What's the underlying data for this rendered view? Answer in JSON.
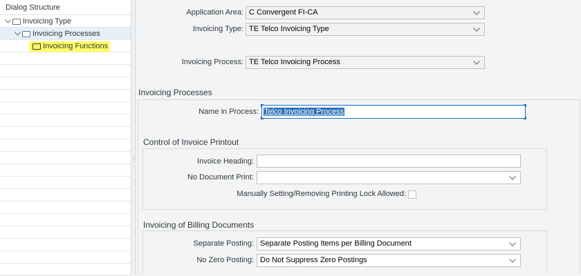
{
  "dialog_structure": {
    "title": "Dialog Structure",
    "items": [
      {
        "label": "Invoicing Type"
      },
      {
        "label": "Invoicing Processes"
      },
      {
        "label": "Invoicing Functions"
      }
    ]
  },
  "header_fields": {
    "application_area": {
      "label": "Application Area:",
      "value": "C Convergent FI-CA"
    },
    "invoicing_type": {
      "label": "Invoicing Type:",
      "value": "TE Telco Invoicing Type"
    },
    "invoicing_process": {
      "label": "Invoicing Process:",
      "value": "TE Telco Invoicing Process"
    }
  },
  "invoicing_processes": {
    "title": "Invoicing Processes",
    "name_in_process": {
      "label": "Name in Process:",
      "value": "Telco Invoicing Process"
    }
  },
  "invoice_printout": {
    "title": "Control of Invoice Printout",
    "invoice_heading": {
      "label": "Invoice Heading:",
      "value": ""
    },
    "no_document_print": {
      "label": "No Document Print:",
      "value": ""
    },
    "printing_lock": {
      "label": "Manually Setting/Removing Printing Lock Allowed:",
      "checked": false
    }
  },
  "billing_documents": {
    "title": "Invoicing of Billing Documents",
    "separate_posting": {
      "label": "Separate Posting:",
      "value": "Separate Posting Items per Billing Document"
    },
    "no_zero_posting": {
      "label": "No Zero Posting:",
      "value": "Do Not Suppress Zero Postings"
    }
  },
  "colors": {
    "highlight": "#ffff66",
    "selection": "#3070b8",
    "focus_border": "#0a6ed1"
  }
}
